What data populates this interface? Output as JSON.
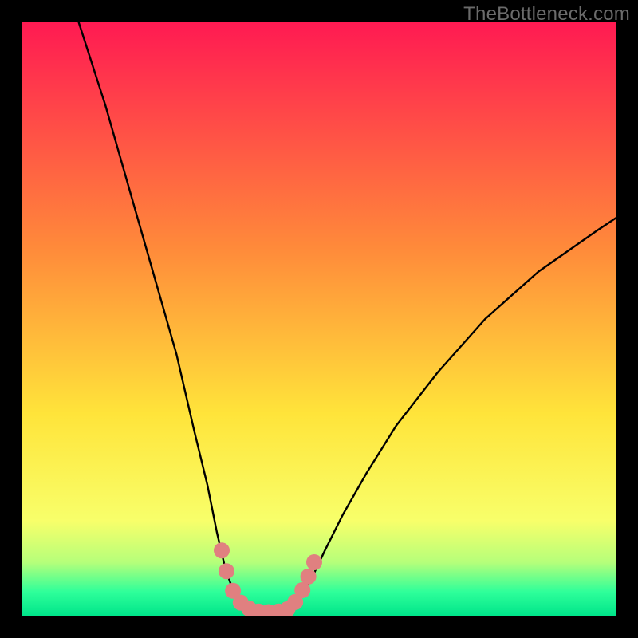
{
  "watermark": "TheBottleneck.com",
  "colors": {
    "frame": "#000000",
    "curve": "#000000",
    "marker_fill": "#e08080",
    "marker_stroke": "#b85a5a",
    "grad_top": "#ff1a52",
    "grad_mid1": "#ff8a3a",
    "grad_mid2": "#ffe43a",
    "grad_low": "#f8ff6a",
    "grad_green1": "#b6ff7a",
    "grad_green2": "#2eff9a",
    "grad_bottom": "#00e58a"
  },
  "chart_data": {
    "type": "line",
    "title": "",
    "xlabel": "",
    "ylabel": "",
    "xlim": [
      0,
      100
    ],
    "ylim": [
      0,
      100
    ],
    "curve_left": [
      {
        "x": 9.5,
        "y": 100
      },
      {
        "x": 14,
        "y": 86
      },
      {
        "x": 18,
        "y": 72
      },
      {
        "x": 22,
        "y": 58
      },
      {
        "x": 26,
        "y": 44
      },
      {
        "x": 29,
        "y": 31
      },
      {
        "x": 31.2,
        "y": 22
      },
      {
        "x": 32.8,
        "y": 14
      },
      {
        "x": 34.2,
        "y": 8
      },
      {
        "x": 35.6,
        "y": 4
      },
      {
        "x": 37,
        "y": 1.8
      },
      {
        "x": 38.5,
        "y": 0.9
      }
    ],
    "curve_floor": [
      {
        "x": 38.5,
        "y": 0.9
      },
      {
        "x": 40.5,
        "y": 0.6
      },
      {
        "x": 43,
        "y": 0.6
      },
      {
        "x": 45,
        "y": 0.9
      }
    ],
    "curve_right": [
      {
        "x": 45,
        "y": 0.9
      },
      {
        "x": 46.2,
        "y": 2
      },
      {
        "x": 47.6,
        "y": 4.2
      },
      {
        "x": 49.2,
        "y": 7.2
      },
      {
        "x": 51,
        "y": 11
      },
      {
        "x": 54,
        "y": 17
      },
      {
        "x": 58,
        "y": 24
      },
      {
        "x": 63,
        "y": 32
      },
      {
        "x": 70,
        "y": 41
      },
      {
        "x": 78,
        "y": 50
      },
      {
        "x": 87,
        "y": 58
      },
      {
        "x": 97,
        "y": 65
      },
      {
        "x": 100,
        "y": 67
      }
    ],
    "markers": [
      {
        "x": 33.6,
        "y": 11
      },
      {
        "x": 34.4,
        "y": 7.5
      },
      {
        "x": 35.5,
        "y": 4.2
      },
      {
        "x": 36.8,
        "y": 2.2
      },
      {
        "x": 38.2,
        "y": 1.2
      },
      {
        "x": 39.8,
        "y": 0.7
      },
      {
        "x": 41.5,
        "y": 0.6
      },
      {
        "x": 43.2,
        "y": 0.7
      },
      {
        "x": 44.7,
        "y": 1.1
      },
      {
        "x": 46.0,
        "y": 2.3
      },
      {
        "x": 47.2,
        "y": 4.3
      },
      {
        "x": 48.2,
        "y": 6.6
      },
      {
        "x": 49.2,
        "y": 9.0
      }
    ],
    "marker_radius_px": 10
  }
}
